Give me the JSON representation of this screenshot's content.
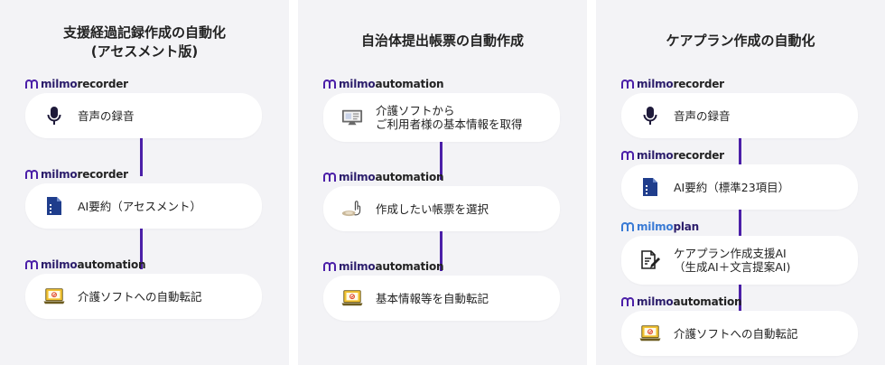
{
  "panels": [
    {
      "title_line1": "支援経過記録作成の自動化",
      "title_line2": "(アセスメント版)",
      "steps": [
        {
          "brand_a": "milmo",
          "brand_b": "recorder",
          "icon": "microphone-icon",
          "label": "音声の録音"
        },
        {
          "brand_a": "milmo",
          "brand_b": "recorder",
          "icon": "document-icon",
          "label": "AI要約（アセスメント）"
        },
        {
          "brand_a": "milmo",
          "brand_b": "automation",
          "icon": "laptop-icon",
          "label": "介護ソフトへの自動転記"
        }
      ]
    },
    {
      "title_line1": "自治体提出帳票の自動作成",
      "steps": [
        {
          "brand_a": "milmo",
          "brand_b": "automation",
          "icon": "monitor-icon",
          "label": "介護ソフトから\nご利用者様の基本情報を取得"
        },
        {
          "brand_a": "milmo",
          "brand_b": "automation",
          "icon": "pointer-click-icon",
          "label": "作成したい帳票を選択"
        },
        {
          "brand_a": "milmo",
          "brand_b": "automation",
          "icon": "laptop-icon",
          "label": "基本情報等を自動転記"
        }
      ]
    },
    {
      "title_line1": "ケアプラン作成の自動化",
      "steps": [
        {
          "brand_a": "milmo",
          "brand_b": "recorder",
          "icon": "microphone-icon",
          "label": "音声の録音"
        },
        {
          "brand_a": "milmo",
          "brand_b": "recorder",
          "icon": "document-icon",
          "label": "AI要約（標準23項目）"
        },
        {
          "brand_a": "milmo",
          "brand_b": "plan",
          "icon": "document-edit-icon",
          "label": "ケアプラン作成支援AI\n（生成AI＋文言提案AI)"
        },
        {
          "brand_a": "milmo",
          "brand_b": "automation",
          "icon": "laptop-icon",
          "label": "介護ソフトへの自動転記"
        }
      ]
    }
  ],
  "colors": {
    "accent": "#4b1fa8",
    "brand_dark": "#2b1d6b",
    "panel_bg": "#f3f3f6",
    "card_bg": "#ffffff",
    "laptop_yellow": "#f2c230"
  }
}
